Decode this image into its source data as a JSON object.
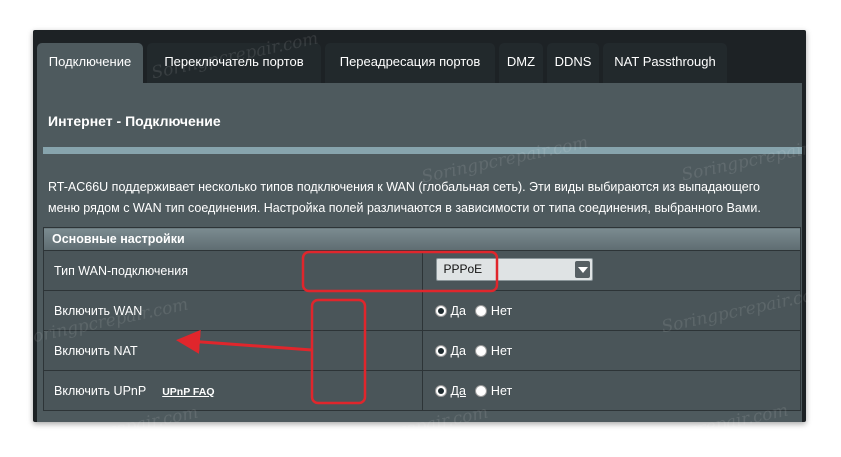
{
  "tabs": [
    {
      "label": "Подключение",
      "active": true
    },
    {
      "label": "Переключатель портов",
      "active": false
    },
    {
      "label": "Переадресация портов",
      "active": false
    },
    {
      "label": "DMZ",
      "active": false
    },
    {
      "label": "DDNS",
      "active": false
    },
    {
      "label": "NAT Passthrough",
      "active": false
    }
  ],
  "page": {
    "title": "Интернет - Подключение",
    "description_line1": "RT-AC66U поддерживает несколько типов подключения к WAN (глобальная сеть). Эти виды выбираются из выпадающего",
    "description_line2": "меню рядом с WAN тип соединения. Настройка полей различаются в зависимости от типа соединения, выбранного Вами."
  },
  "settings": {
    "header": "Основные настройки",
    "wan_type": {
      "label": "Тип WAN-подключения",
      "value": "PPPoE"
    },
    "enable_wan": {
      "label": "Включить WAN",
      "yes": "Да",
      "no": "Нет",
      "selected": "yes"
    },
    "enable_nat": {
      "label": "Включить NAT",
      "yes": "Да",
      "no": "Нет",
      "selected": "yes"
    },
    "enable_upnp": {
      "label": "Включить UPnP",
      "link": "UPnP  FAQ",
      "yes": "Да",
      "no": "Нет",
      "selected": "yes"
    }
  },
  "watermark": "Soringpcrepair.com",
  "colors": {
    "accent": "#e0262c",
    "panel": "#4e5a5e",
    "frame": "#1d2225",
    "rule": "#87a4ad"
  }
}
